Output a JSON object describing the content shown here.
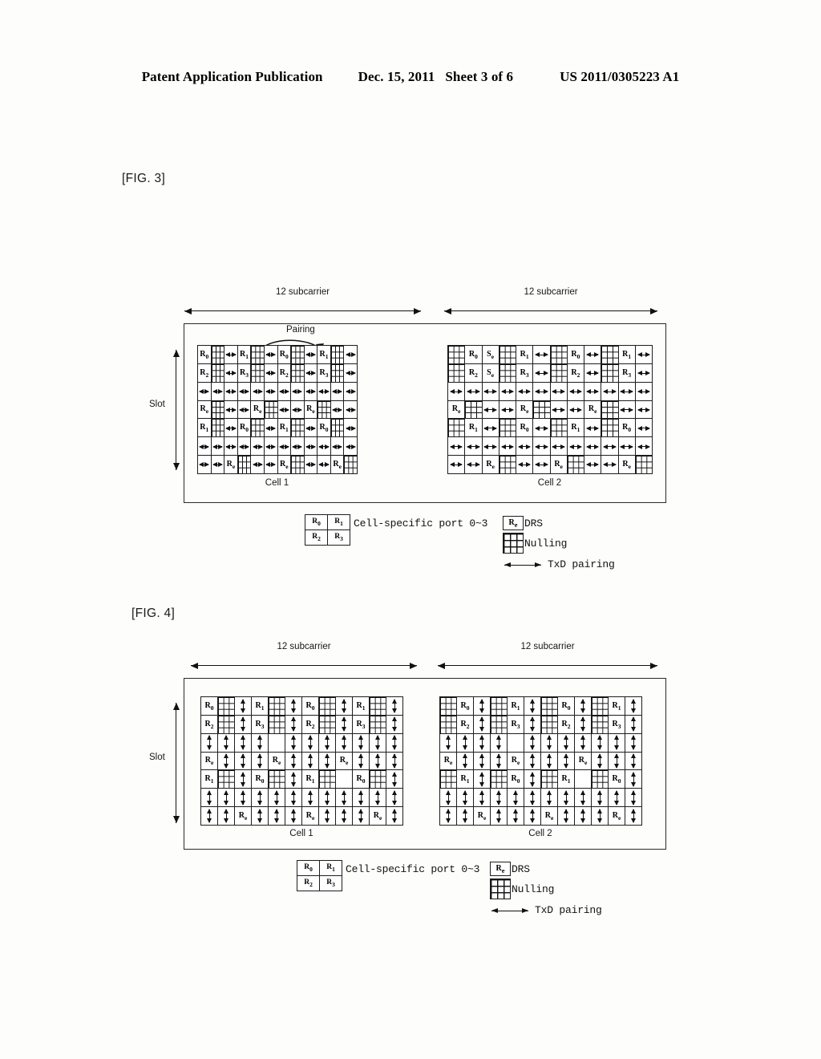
{
  "header": {
    "publication": "Patent Application Publication",
    "date": "Dec. 15, 2011",
    "sheet": "Sheet 3 of 6",
    "patent_number": "US 2011/0305223 A1"
  },
  "figures": [
    {
      "label": "[FIG. 3]",
      "axis": {
        "subcarrier_left": "12 subcarrier",
        "subcarrier_right": "12 subcarrier",
        "slot": "Slot"
      },
      "annotation": "Pairing",
      "cells": [
        {
          "caption": "Cell 1"
        },
        {
          "caption": "Cell 2"
        }
      ],
      "legend": {
        "ports": [
          "R0",
          "R1",
          "R2",
          "R3"
        ],
        "ports_text": "Cell-specific port 0~3",
        "drs_symbol": "Re",
        "drs_text": "DRS",
        "nulling_text": "Nulling",
        "pairing_text": "TxD pairing"
      }
    },
    {
      "label": "[FIG. 4]",
      "axis": {
        "subcarrier_left": "12 subcarrier",
        "subcarrier_right": "12 subcarrier",
        "slot": "Slot"
      },
      "annotation": "",
      "cells": [
        {
          "caption": "Cell 1"
        },
        {
          "caption": "Cell 2"
        }
      ],
      "legend": {
        "ports": [
          "R0",
          "R1",
          "R2",
          "R3"
        ],
        "ports_text": "Cell-specific port 0~3",
        "drs_symbol": "Re",
        "drs_text": "DRS",
        "nulling_text": "Nulling",
        "pairing_text": "TxD pairing"
      }
    }
  ],
  "grids": {
    "fig3_cell1": [
      [
        "R0",
        "NULL",
        "ARR",
        "R1",
        "NULL",
        "ARR",
        "R0",
        "NULL",
        "ARR",
        "R1",
        "NULL",
        "ARR"
      ],
      [
        "R2",
        "NULL",
        "ARR",
        "R3",
        "NULL",
        "ARR",
        "R2",
        "NULL",
        "ARR",
        "R3",
        "NULL",
        "ARR"
      ],
      [
        "ARR",
        "ARR",
        "ARR",
        "ARR",
        "ARR",
        "ARR",
        "ARR",
        "ARR",
        "ARR",
        "ARR",
        "ARR",
        "ARR"
      ],
      [
        "Re",
        "NULL",
        "ARR",
        "ARR",
        "Re",
        "NULL",
        "ARR",
        "ARR",
        "Re",
        "NULL",
        "ARR",
        "ARR"
      ],
      [
        "R1",
        "NULL",
        "ARR",
        "R0",
        "NULL",
        "ARR",
        "R1",
        "NULL",
        "ARR",
        "R0",
        "NULL",
        "ARR"
      ],
      [
        "ARR",
        "ARR",
        "ARR",
        "ARR",
        "ARR",
        "ARR",
        "ARR",
        "ARR",
        "ARR",
        "ARR",
        "ARR",
        "ARR"
      ],
      [
        "ARR",
        "ARR",
        "Re",
        "NULL",
        "ARR",
        "ARR",
        "Re",
        "NULL",
        "ARR",
        "ARR",
        "Re",
        "NULL"
      ]
    ],
    "fig3_cell2": [
      [
        "NULL",
        "R0",
        "Se",
        "NULL",
        "R1",
        "ARR",
        "NULL",
        "R0",
        "ARR",
        "NULL",
        "R1",
        "ARR"
      ],
      [
        "NULL",
        "R2",
        "Se",
        "NULL",
        "R3",
        "ARR",
        "NULL",
        "R2",
        "ARR",
        "NULL",
        "R3",
        "ARR"
      ],
      [
        "ARR",
        "ARR",
        "ARR",
        "ARR",
        "ARR",
        "ARR",
        "ARR",
        "ARR",
        "ARR",
        "ARR",
        "ARR",
        "ARR"
      ],
      [
        "Re",
        "NULL",
        "ARR",
        "ARR",
        "Re",
        "NULL",
        "ARR",
        "ARR",
        "Re",
        "NULL",
        "ARR",
        "ARR"
      ],
      [
        "NULL",
        "R1",
        "ARR",
        "NULL",
        "R0",
        "ARR",
        "NULL",
        "R1",
        "ARR",
        "NULL",
        "R0",
        "ARR"
      ],
      [
        "ARR",
        "ARR",
        "ARR",
        "ARR",
        "ARR",
        "ARR",
        "ARR",
        "ARR",
        "ARR",
        "ARR",
        "ARR",
        "ARR"
      ],
      [
        "ARR",
        "ARR",
        "Re",
        "NULL",
        "ARR",
        "ARR",
        "Re",
        "NULL",
        "ARR",
        "ARR",
        "Re",
        "NULL"
      ]
    ],
    "fig4_cell1": [
      [
        "R0",
        "NULL",
        "VAR",
        "R1",
        "NULL",
        "VAR",
        "R0",
        "NULL",
        "VAR",
        "R1",
        "NULL",
        "VAR"
      ],
      [
        "R2",
        "NULL",
        "VAR",
        "R3",
        "NULL",
        "VAR",
        "R2",
        "NULL",
        "VAR",
        "R3",
        "NULL",
        "VAR"
      ],
      [
        "VAR",
        "VAR",
        "VAR",
        "VAR",
        "BLANK",
        "VAR",
        "VAR",
        "VAR",
        "VAR",
        "VAR",
        "VAR",
        "VAR"
      ],
      [
        "Re",
        "VAR",
        "VAR",
        "VAR",
        "Re",
        "VAR",
        "VAR",
        "VAR",
        "Re",
        "VAR",
        "VAR",
        "VAR"
      ],
      [
        "R1",
        "NULL",
        "VAR",
        "R0",
        "NULL",
        "VAR",
        "R1",
        "NULL",
        "BLANK",
        "R0",
        "NULL",
        "VAR"
      ],
      [
        "VAR",
        "VAR",
        "VAR",
        "VAR",
        "VAR",
        "VAR",
        "VAR",
        "VAR",
        "VAR",
        "VAR",
        "VAR",
        "VAR"
      ],
      [
        "VAR",
        "VAR",
        "Re",
        "VAR",
        "VAR",
        "VAR",
        "Re",
        "VAR",
        "VAR",
        "VAR",
        "Re",
        "VAR"
      ]
    ],
    "fig4_cell2": [
      [
        "NULL",
        "R0",
        "VAR",
        "NULL",
        "R1",
        "VAR",
        "NULL",
        "R0",
        "VAR",
        "NULL",
        "R1",
        "VAR"
      ],
      [
        "NULL",
        "R2",
        "VAR",
        "NULL",
        "R3",
        "VAR",
        "NULL",
        "R2",
        "VAR",
        "NULL",
        "R3",
        "VAR"
      ],
      [
        "VAR",
        "VAR",
        "VAR",
        "VAR",
        "BLANK",
        "VAR",
        "VAR",
        "VAR",
        "VAR",
        "VAR",
        "VAR",
        "VAR"
      ],
      [
        "Re",
        "VAR",
        "VAR",
        "VAR",
        "Re",
        "VAR",
        "VAR",
        "VAR",
        "Re",
        "VAR",
        "VAR",
        "VAR"
      ],
      [
        "NULL",
        "R1",
        "VAR",
        "NULL",
        "R0",
        "VAR",
        "NULL",
        "R1",
        "BLANK",
        "NULL",
        "R0",
        "VAR"
      ],
      [
        "VAR",
        "VAR",
        "VAR",
        "VAR",
        "VAR",
        "VAR",
        "VAR",
        "VAR",
        "VAR",
        "VAR",
        "VAR",
        "VAR"
      ],
      [
        "VAR",
        "VAR",
        "Re",
        "VAR",
        "VAR",
        "VAR",
        "Re",
        "VAR",
        "VAR",
        "VAR",
        "Re",
        "VAR"
      ]
    ]
  }
}
